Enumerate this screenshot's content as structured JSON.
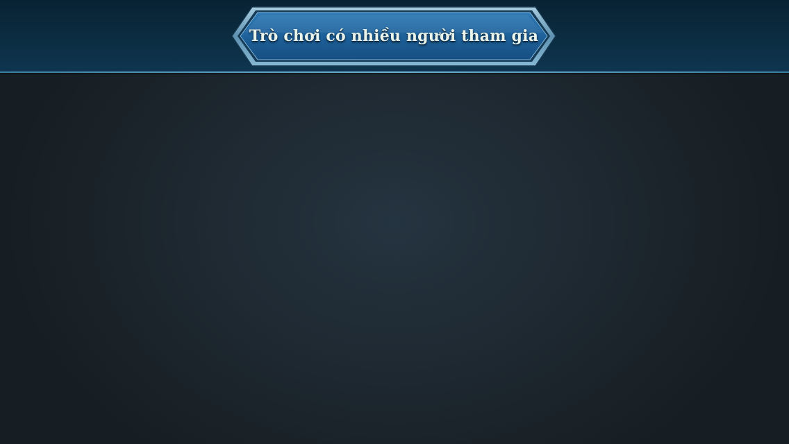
{
  "header": {
    "title": "Trò chơi có nhiều người tham gia"
  }
}
